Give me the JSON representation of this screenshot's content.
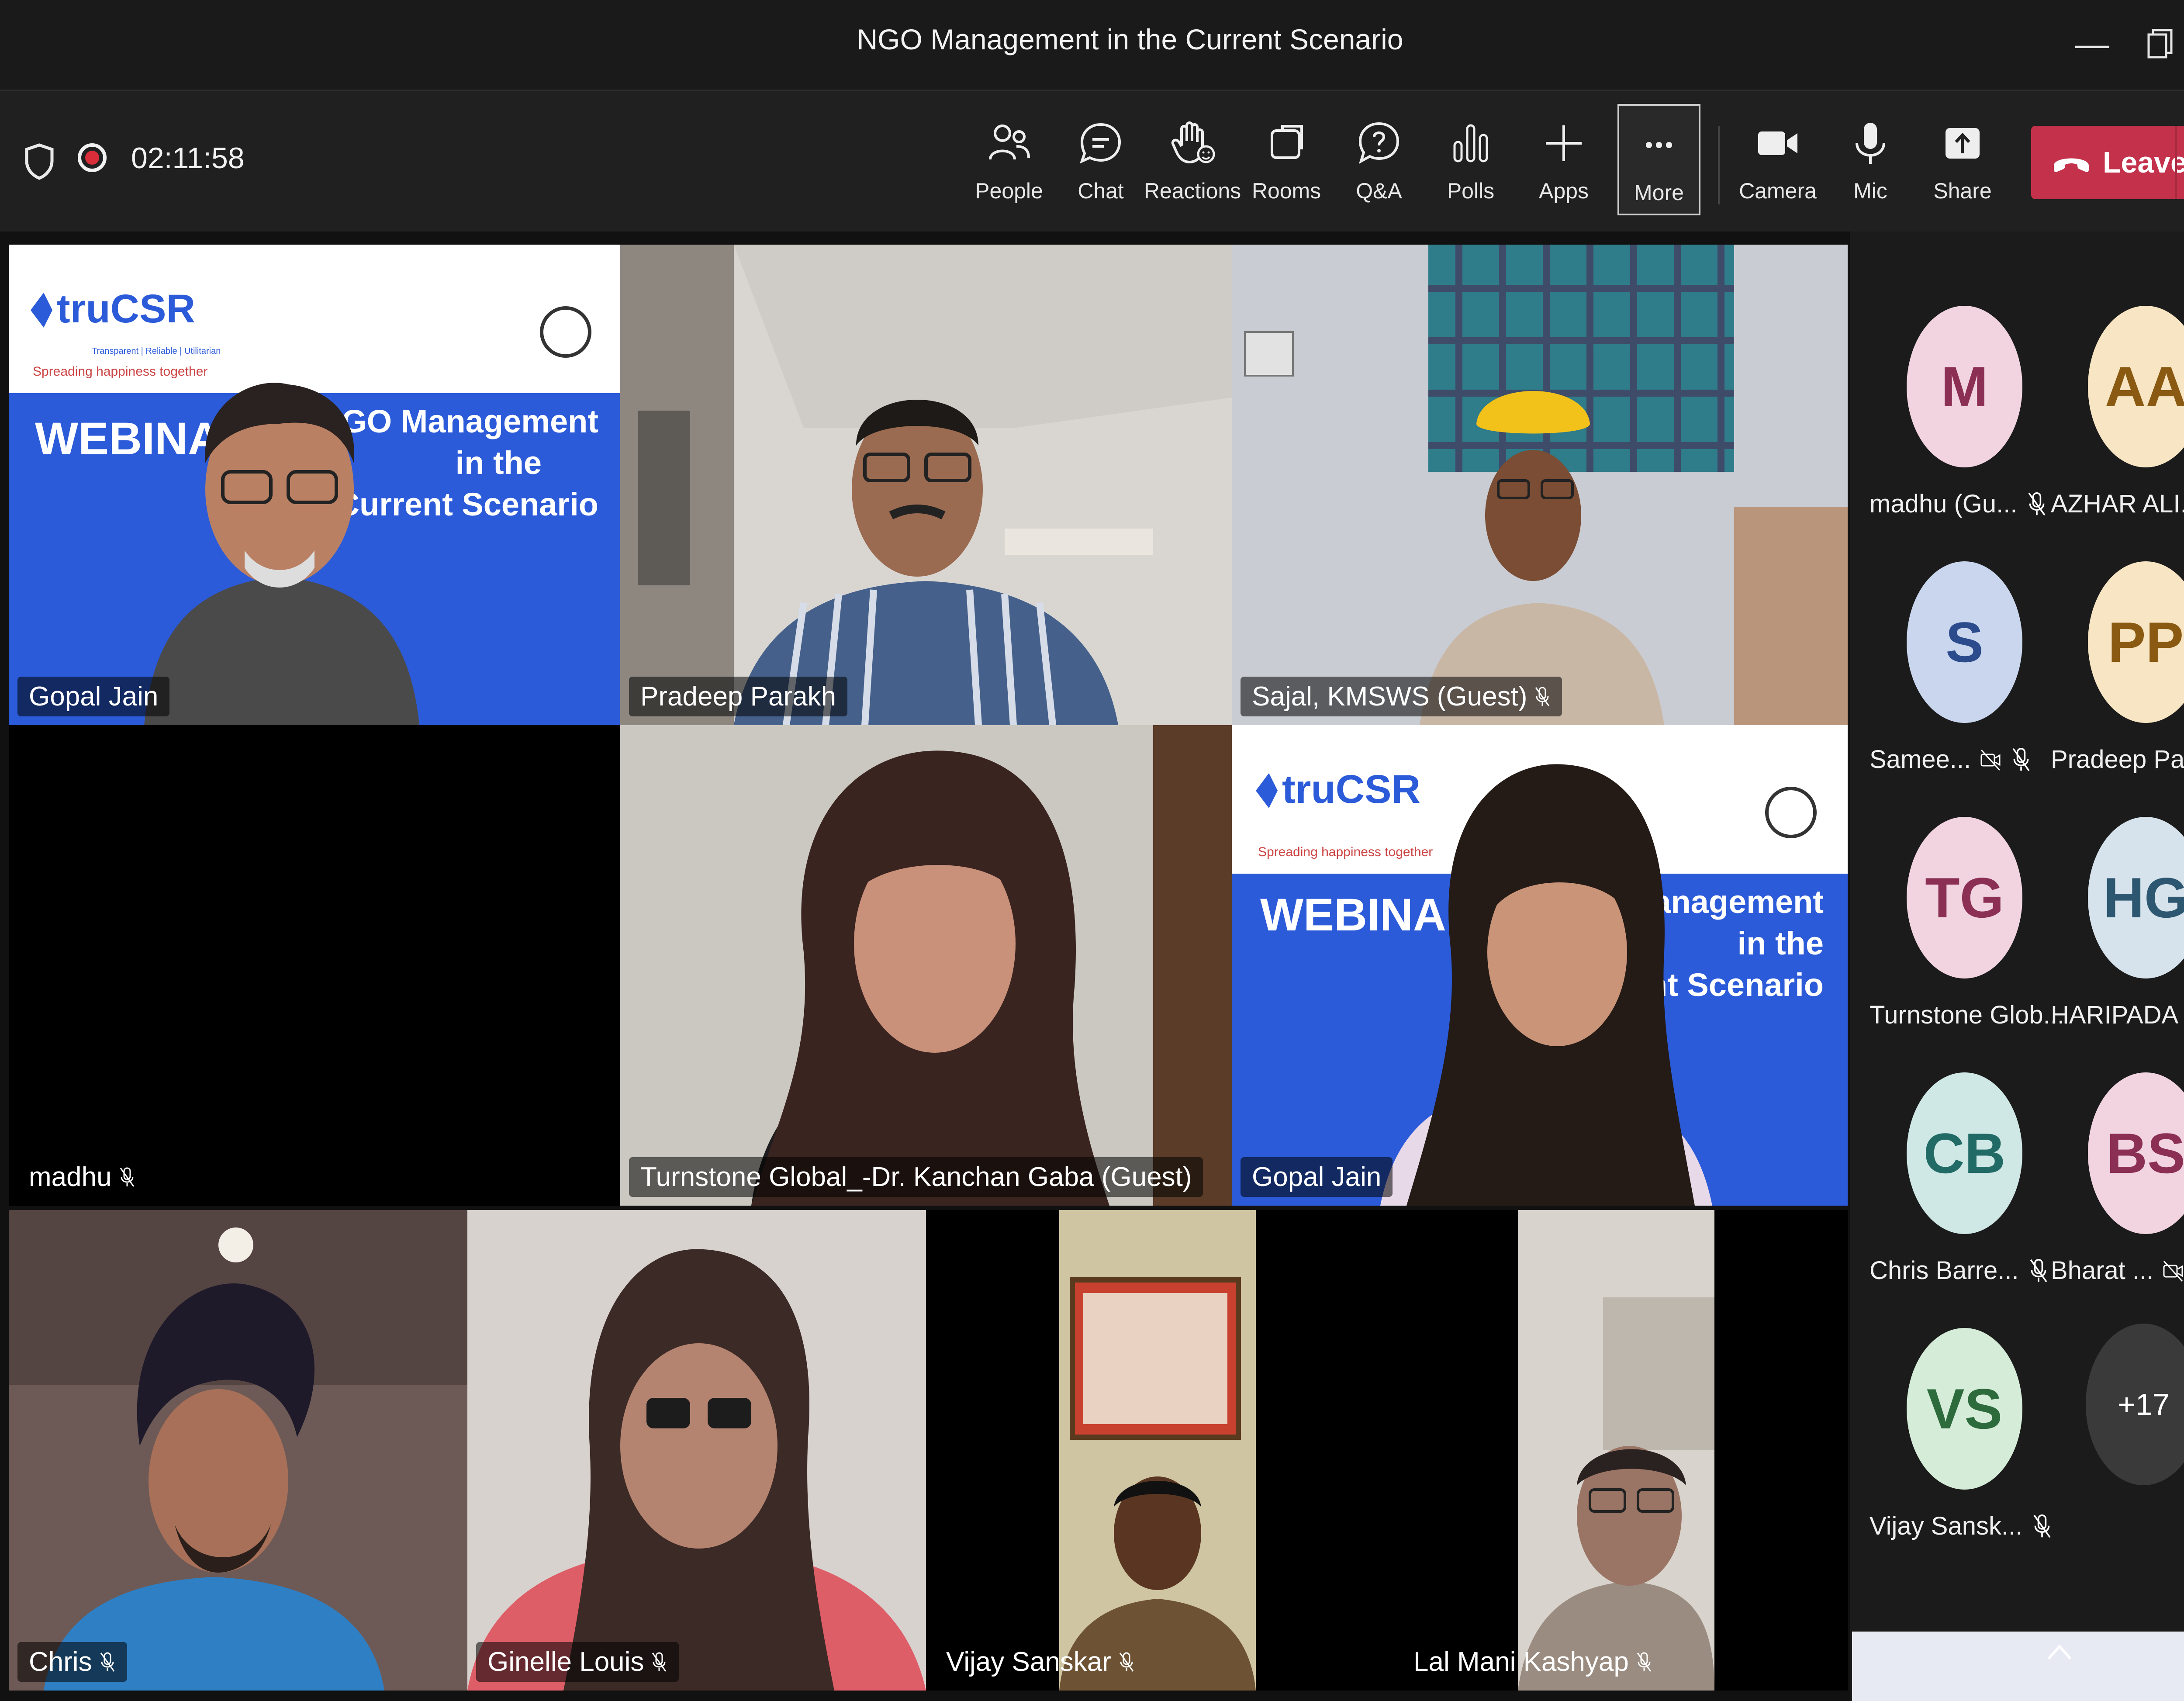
{
  "window": {
    "title": "NGO Management in the Current Scenario"
  },
  "toolbar": {
    "timer": "02:11:58",
    "buttons": [
      {
        "key": "people",
        "label": "People",
        "icon": "people-icon"
      },
      {
        "key": "chat",
        "label": "Chat",
        "icon": "chat-icon"
      },
      {
        "key": "reactions",
        "label": "Reactions",
        "icon": "reactions-icon"
      },
      {
        "key": "rooms",
        "label": "Rooms",
        "icon": "rooms-icon"
      },
      {
        "key": "qa",
        "label": "Q&A",
        "icon": "qa-icon"
      },
      {
        "key": "polls",
        "label": "Polls",
        "icon": "polls-icon"
      },
      {
        "key": "apps",
        "label": "Apps",
        "icon": "plus-icon"
      },
      {
        "key": "more",
        "label": "More",
        "icon": "more-icon"
      },
      {
        "key": "camera",
        "label": "Camera",
        "icon": "camera-icon"
      },
      {
        "key": "mic",
        "label": "Mic",
        "icon": "mic-icon"
      },
      {
        "key": "share",
        "label": "Share",
        "icon": "share-icon"
      }
    ],
    "leave_label": "Leave"
  },
  "tiles": [
    {
      "name": "Gopal Jain",
      "muted": false
    },
    {
      "name": "Pradeep Parakh",
      "muted": false
    },
    {
      "name": "Sajal, KMSWS (Guest)",
      "muted": true
    },
    {
      "name": "madhu",
      "muted": true
    },
    {
      "name": "Turnstone Global_-Dr. Kanchan Gaba (Guest)",
      "muted": false
    },
    {
      "name": "Gopal Jain",
      "muted": false
    },
    {
      "name": "Chris",
      "muted": true
    },
    {
      "name": "Ginelle Louis",
      "muted": true
    },
    {
      "name": "Vijay Sanskar",
      "muted": true
    },
    {
      "name": "Lal Mani Kashyap",
      "muted": true
    }
  ],
  "banner": {
    "brand": "truCSR",
    "brand_sub": "Transparent | Reliable | Utilitarian",
    "tagline": "Spreading happiness together",
    "webinar": "WEBINAR",
    "topic_line1": "NGO Management",
    "topic_line2": "in the",
    "topic_line3": "Current Scenario",
    "topic_partial_line1": "O Management",
    "topic_partial_line3": "rrent Scenario"
  },
  "participants": [
    {
      "initials": "M",
      "name": "madhu (Gu...",
      "bg": "#f1d4e0",
      "fg": "#8c2f54",
      "muted": true,
      "no_cam": false
    },
    {
      "initials": "AA",
      "name": "AZHAR ALI...",
      "bg": "#f7e5c3",
      "fg": "#8a5a12",
      "muted": true,
      "no_cam": false
    },
    {
      "initials": "S",
      "name": "Samee...",
      "bg": "#c9d6ee",
      "fg": "#2c4b8c",
      "muted": true,
      "no_cam": true
    },
    {
      "initials": "PP",
      "name": "Pradeep Parakh",
      "bg": "#f7e5c3",
      "fg": "#8a5a12",
      "muted": false,
      "no_cam": false
    },
    {
      "initials": "TG",
      "name": "Turnstone Glob...",
      "bg": "#f1d4e0",
      "fg": "#8c2f54",
      "muted": false,
      "no_cam": false
    },
    {
      "initials": "HG",
      "name": "HARIPADA ...",
      "bg": "#d6e3ec",
      "fg": "#2d5670",
      "muted": true,
      "no_cam": false
    },
    {
      "initials": "CB",
      "name": "Chris Barre...",
      "bg": "#cfe8e6",
      "fg": "#226a66",
      "muted": true,
      "no_cam": false
    },
    {
      "initials": "BS",
      "name": "Bharat ...",
      "bg": "#f1d4e0",
      "fg": "#8c2f54",
      "muted": true,
      "no_cam": true
    },
    {
      "initials": "VS",
      "name": "Vijay Sansk...",
      "bg": "#d4ecd8",
      "fg": "#2e6b3c",
      "muted": true,
      "no_cam": false
    }
  ],
  "overflow_count": "+17",
  "colors": {
    "leave": "#c4314b",
    "banner_blue": "#2c5bd9",
    "rec": "#d92e3a"
  }
}
